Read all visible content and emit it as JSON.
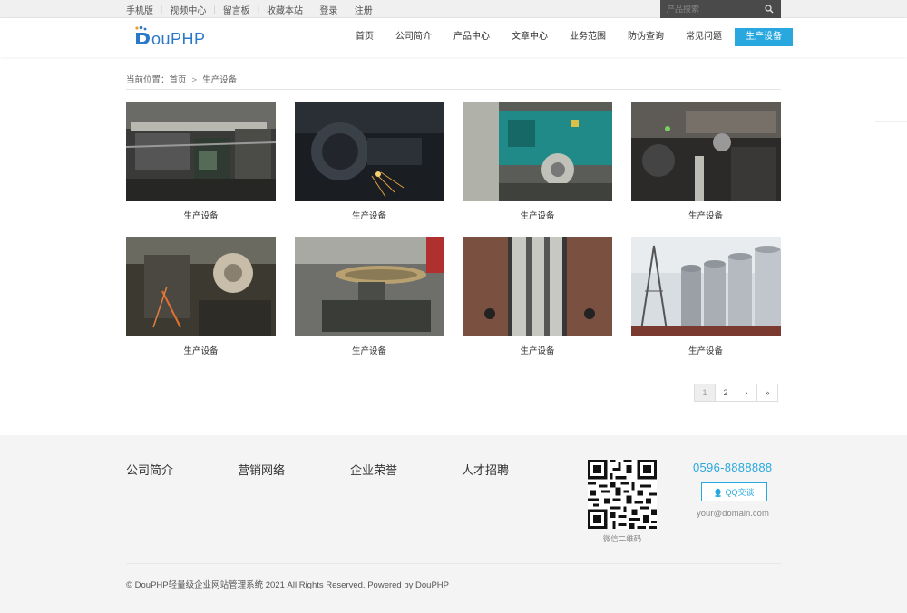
{
  "topbar": {
    "links": [
      "手机版",
      "视频中心",
      "留言板",
      "收藏本站",
      "登录",
      "注册"
    ],
    "search_placeholder": "产品搜索"
  },
  "logo": {
    "text": "ouPHP"
  },
  "nav": {
    "items": [
      "首页",
      "公司简介",
      "产品中心",
      "文章中心",
      "业务范围",
      "防伪查询",
      "常见问题",
      "生产设备"
    ],
    "active_index": 7,
    "active_color": "#29a8e0"
  },
  "breadcrumb": {
    "prefix": "当前位置：",
    "home": "首页",
    "separator": ">",
    "current": "生产设备"
  },
  "products": [
    {
      "caption": "生产设备",
      "image": "industrial-conveyor"
    },
    {
      "caption": "生产设备",
      "image": "motor-sparks"
    },
    {
      "caption": "生产设备",
      "image": "teal-machine-pulley"
    },
    {
      "caption": "生产设备",
      "image": "printing-press"
    },
    {
      "caption": "生产设备",
      "image": "belt-pulley"
    },
    {
      "caption": "生产设备",
      "image": "lathe-gear"
    },
    {
      "caption": "生产设备",
      "image": "mold-press"
    },
    {
      "caption": "生产设备",
      "image": "silos"
    }
  ],
  "pagination": {
    "pages": [
      "1",
      "2"
    ],
    "next": "›",
    "last": "»",
    "current": "1"
  },
  "footer": {
    "columns": [
      "公司简介",
      "营销网络",
      "企业荣誉",
      "人才招聘"
    ],
    "qr_caption": "微信二维码",
    "phone": "0596-8888888",
    "qq_label": "QQ交谈",
    "email": "your@domain.com",
    "copyright": "© DouPHP轻量级企业网站管理系统 2021 All Rights Reserved. Powered by DouPHP"
  }
}
